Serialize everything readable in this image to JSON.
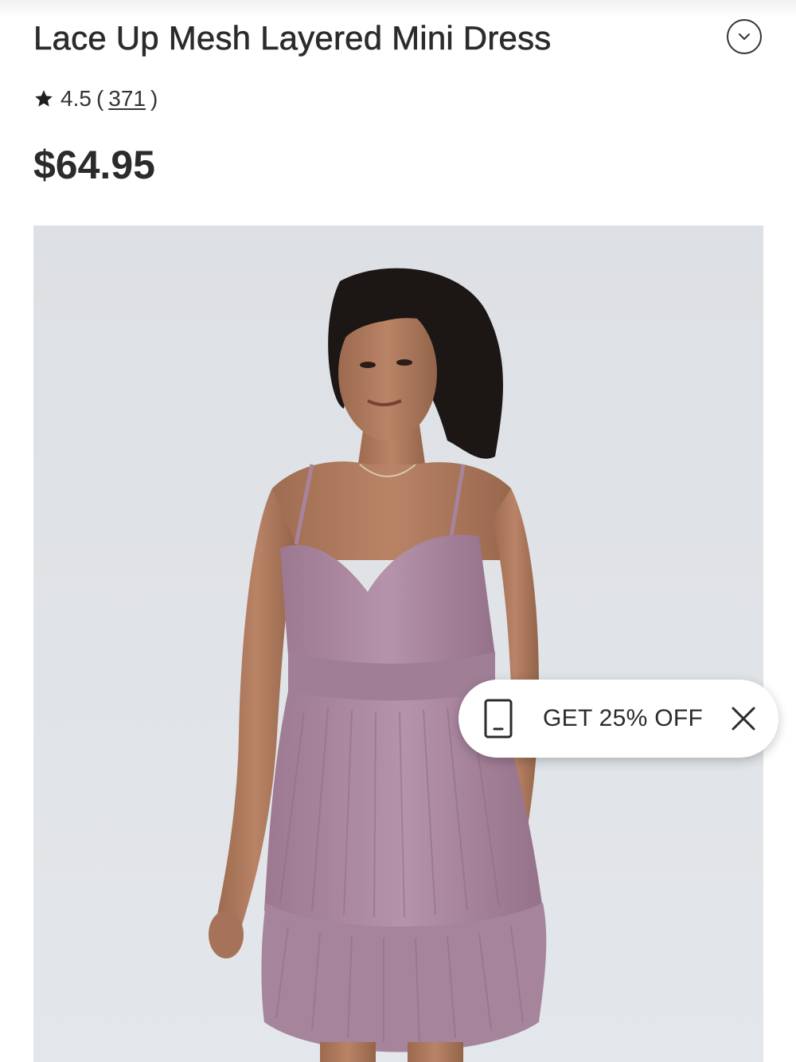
{
  "product": {
    "title": "Lace Up Mesh Layered Mini Dress",
    "rating": "4.5",
    "rating_open": "(",
    "review_count": "371",
    "rating_close": ")",
    "price": "$64.95"
  },
  "promo": {
    "label": "GET 25% OFF",
    "icon": "phone-icon",
    "close_icon": "close-icon"
  },
  "icons": {
    "expand": "chevron-down-icon",
    "rating": "star-icon"
  },
  "colors": {
    "text": "#2b2b2b",
    "image_background": "#dfe2e6",
    "dress": "#a7839c",
    "promo_background": "#ffffff"
  }
}
